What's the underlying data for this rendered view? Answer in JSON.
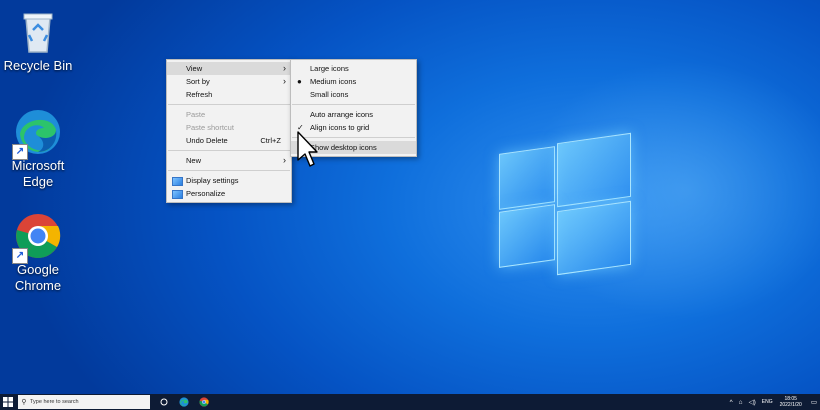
{
  "desktop": {
    "icons": [
      {
        "label": "Recycle Bin",
        "icon": "recycle-bin-icon"
      },
      {
        "label": "Microsoft Edge",
        "icon": "edge-icon"
      },
      {
        "label": "Google Chrome",
        "icon": "chrome-icon"
      }
    ]
  },
  "context_menu": {
    "view": "View",
    "sort_by": "Sort by",
    "refresh": "Refresh",
    "paste": "Paste",
    "paste_shortcut": "Paste shortcut",
    "undo_delete": "Undo Delete",
    "undo_shortcut": "Ctrl+Z",
    "new": "New",
    "display_settings": "Display settings",
    "personalize": "Personalize"
  },
  "view_submenu": {
    "large_icons": "Large icons",
    "medium_icons": "Medium icons",
    "small_icons": "Small icons",
    "auto_arrange": "Auto arrange icons",
    "align_to_grid": "Align icons to grid",
    "show_desktop_icons": "Show desktop icons",
    "selected_size": "Medium icons"
  },
  "taskbar": {
    "search_placeholder": "Type here to search",
    "language": "ENG",
    "time": "18:05",
    "date": "2022/1/20"
  },
  "colors": {
    "taskbar_bg": "#0d1b35",
    "menu_bg": "#f2f2f2",
    "menu_hover": "#dadada"
  }
}
